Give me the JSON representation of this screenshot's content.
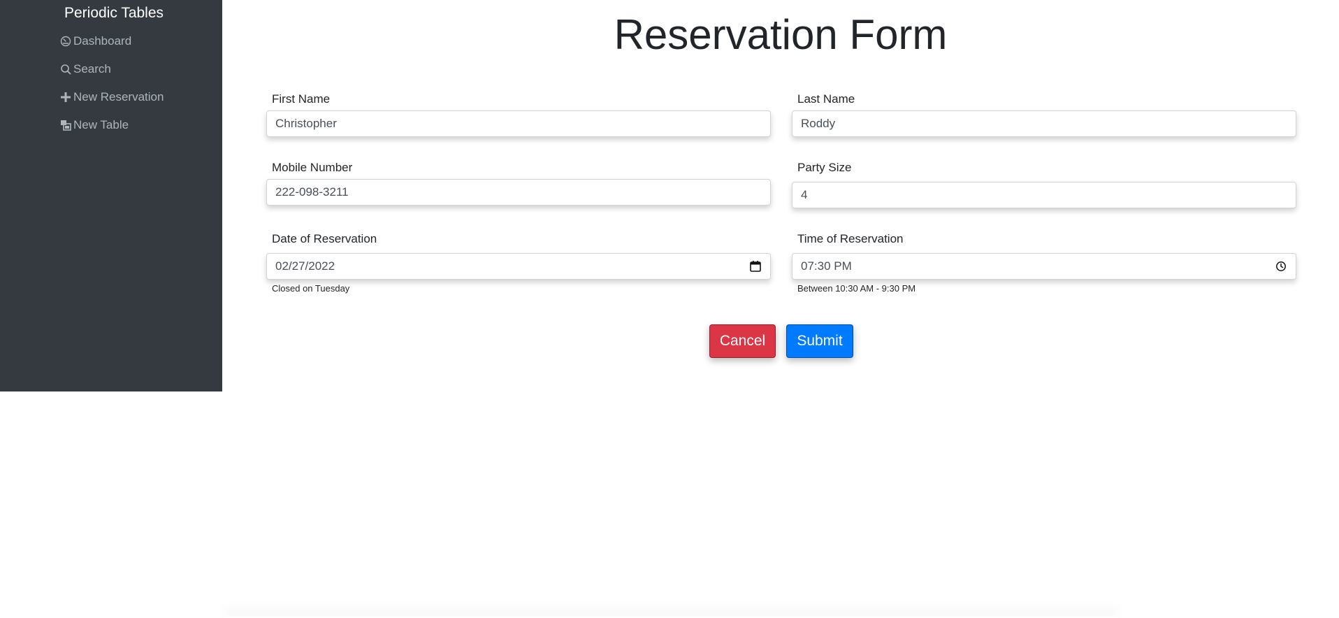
{
  "app": {
    "brand": "Periodic Tables"
  },
  "sidebar": {
    "items": [
      {
        "label": "Dashboard",
        "icon": "dashboard-icon"
      },
      {
        "label": "Search",
        "icon": "search-icon"
      },
      {
        "label": "New Reservation",
        "icon": "plus-icon"
      },
      {
        "label": "New Table",
        "icon": "tables-icon"
      }
    ]
  },
  "form": {
    "title": "Reservation Form",
    "first_name": {
      "label": "First Name",
      "value": "Christopher"
    },
    "last_name": {
      "label": "Last Name",
      "value": "Roddy"
    },
    "mobile_number": {
      "label": "Mobile Number",
      "value": "222-098-3211"
    },
    "party_size": {
      "label": "Party Size",
      "value": "4"
    },
    "date": {
      "label": "Date of Reservation",
      "value": "02/27/2022",
      "help": "Closed on Tuesday",
      "icon": "calendar-icon"
    },
    "time": {
      "label": "Time of Reservation",
      "value": "07:30 PM",
      "help": "Between 10:30 AM - 9:30 PM",
      "icon": "clock-icon"
    },
    "cancel_label": "Cancel",
    "submit_label": "Submit"
  },
  "colors": {
    "sidebar_bg": "#343a40",
    "cancel": "#dc3545",
    "submit": "#007bff"
  }
}
